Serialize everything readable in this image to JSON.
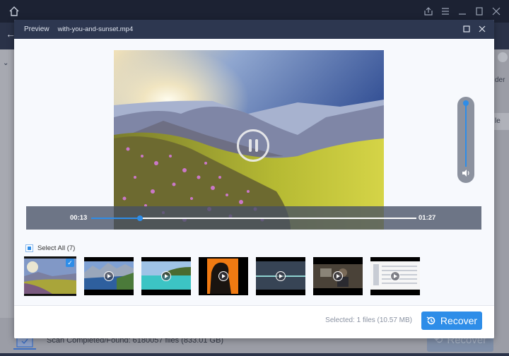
{
  "app": {
    "status_text": "Scan Completed/Found: 6180057 files (833.01 GB)",
    "recover_label": "Recover",
    "right_text_1": "der",
    "right_text_2": "le"
  },
  "dialog": {
    "title": "Preview",
    "filename": "with-you-and-sunset.mp4",
    "player": {
      "current_time": "00:13",
      "duration": "01:27",
      "progress": 0.149,
      "volume": 1.0,
      "state": "playing"
    },
    "select_all": {
      "label": "Select All (7)",
      "state": "partial"
    },
    "thumbnails": [
      {
        "name": "mountain-flowers-sunset",
        "selected": true,
        "has_play": false
      },
      {
        "name": "mountain-lake",
        "selected": false,
        "has_play": true
      },
      {
        "name": "tropical-sea",
        "selected": false,
        "has_play": true
      },
      {
        "name": "live-songs-poster",
        "selected": false,
        "has_play": true
      },
      {
        "name": "dark-line",
        "selected": false,
        "has_play": true
      },
      {
        "name": "man-talking",
        "selected": false,
        "has_play": true
      },
      {
        "name": "spreadsheet-recording",
        "selected": false,
        "has_play": true
      }
    ],
    "footer": {
      "selected_info": "Selected: 1 files (10.57 MB)",
      "recover_label": "Recover"
    }
  },
  "colors": {
    "accent": "#2e8de8",
    "header": "#2d3750",
    "titlebar": "#1c2233"
  }
}
